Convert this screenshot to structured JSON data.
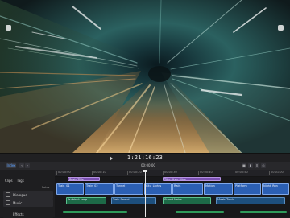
{
  "app": {
    "viewer_image": "Motion-blurred train tunnel footage",
    "accent": "#4a8cf2"
  },
  "transport": {
    "timecode": "1:21:16:23"
  },
  "toolbar": {
    "index_label": "Index",
    "project_label": "00:00:00"
  },
  "index": {
    "tabs": [
      "Clips",
      "Tags",
      "Roles"
    ],
    "header": "Roles",
    "roles": [
      "Dialogue",
      "Music",
      "Effects"
    ]
  },
  "ruler": {
    "ticks": [
      "00:00:00",
      "00:00:10",
      "00:00:20",
      "00:00:30",
      "00:00:40",
      "00:00:50",
      "00:01:00"
    ]
  },
  "timeline": {
    "title_clips": [
      "Basic Title",
      "Title Style Slide"
    ],
    "video_clips": [
      "Train_01",
      "Train_02",
      "Tunnel",
      "City_Lights",
      "Rails",
      "Motion",
      "Platform",
      "Night_Run"
    ],
    "audio_clips": [
      "Ambient Loop",
      "Train Sound",
      "Crowd Noise",
      "Music Track"
    ]
  }
}
